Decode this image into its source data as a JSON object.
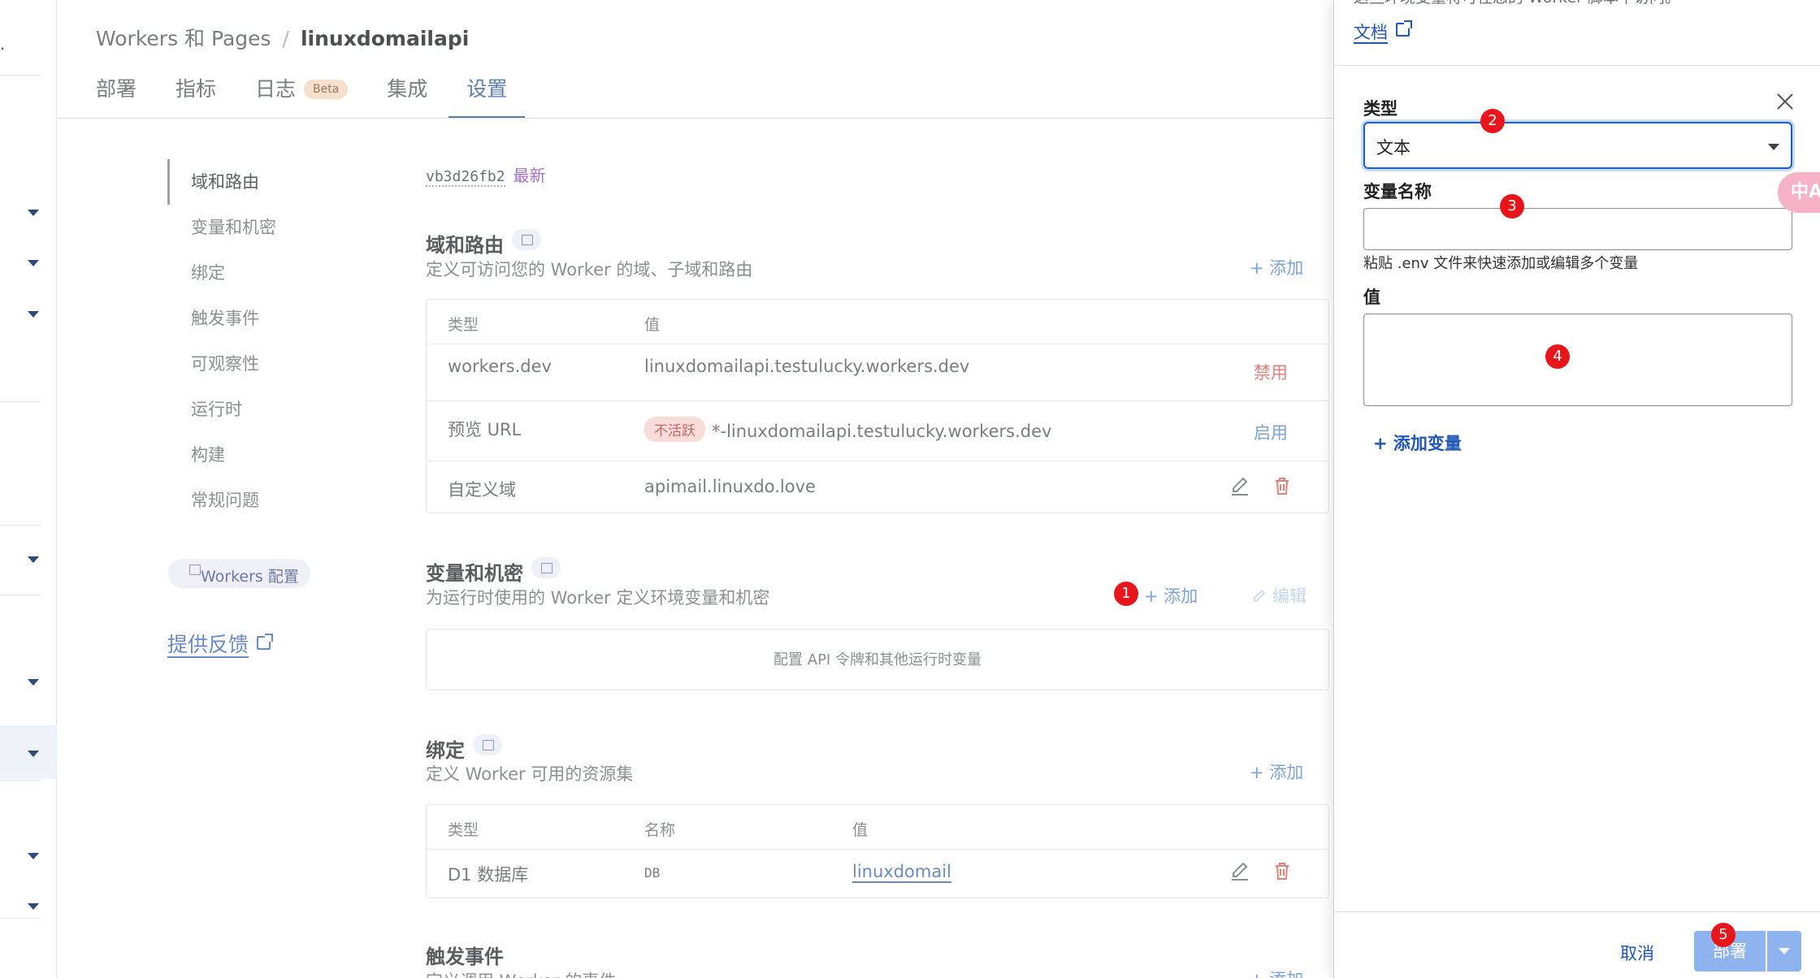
{
  "breadcrumb": {
    "parent": "Workers 和 Pages",
    "separator": "/",
    "current": "linuxdomailapi"
  },
  "tabs": [
    {
      "label": "部署"
    },
    {
      "label": "指标"
    },
    {
      "label": "日志",
      "badge": "Beta"
    },
    {
      "label": "集成"
    },
    {
      "label": "设置",
      "active": true
    }
  ],
  "side_nav": {
    "items": [
      "域和路由",
      "变量和机密",
      "绑定",
      "触发事件",
      "可观察性",
      "运行时",
      "构建",
      "常规问题"
    ],
    "workers_config": "Workers 配置",
    "feedback": "提供反馈"
  },
  "version": {
    "prefix": "v",
    "code": "b3d26fb2",
    "latest": "最新"
  },
  "domains": {
    "title": "域和路由",
    "desc": "定义可访问您的 Worker 的域、子域和路由",
    "add": "+ 添加",
    "headers": {
      "type": "类型",
      "value": "值"
    },
    "rows": [
      {
        "type": "workers.dev",
        "value": "linuxdomailapi.testulucky.workers.dev",
        "action": "禁用"
      },
      {
        "type": "预览 URL",
        "badge": "不活跃",
        "value": "*-linuxdomailapi.testulucky.workers.dev",
        "action": "启用"
      },
      {
        "type": "自定义域",
        "value": "apimail.linuxdo.love"
      }
    ]
  },
  "variables": {
    "title": "变量和机密",
    "desc": "为运行时使用的 Worker 定义环境变量和机密",
    "add": "+ 添加",
    "edit": "编辑",
    "empty": "配置 API 令牌和其他运行时变量"
  },
  "bindings": {
    "title": "绑定",
    "desc": "定义 Worker 可用的资源集",
    "add": "+ 添加",
    "headers": {
      "type": "类型",
      "name": "名称",
      "value": "值"
    },
    "rows": [
      {
        "type": "D1 数据库",
        "name": "DB",
        "value": "linuxdomail"
      }
    ]
  },
  "triggers": {
    "title": "触发事件",
    "desc": "定义调用 Worker 的事件",
    "add": "+ 添加"
  },
  "drawer": {
    "top_text": "这些环境变量将可在您的 Worker 脚本中访问。",
    "doc_link": "文档",
    "type_label": "类型",
    "type_value": "文本",
    "name_label": "变量名称",
    "name_value": "",
    "paste_hint": "粘贴 .env 文件来快速添加或编辑多个变量",
    "value_label": "值",
    "value_value": "",
    "add_variable": "+ 添加变量",
    "cancel": "取消",
    "deploy": "部署"
  },
  "translate_bubble": "中A",
  "markers": [
    "1",
    "2",
    "3",
    "4",
    "5"
  ],
  "colors": {
    "accent": "#1f56b8",
    "danger": "#e2807c",
    "marker": "#e8161b"
  }
}
